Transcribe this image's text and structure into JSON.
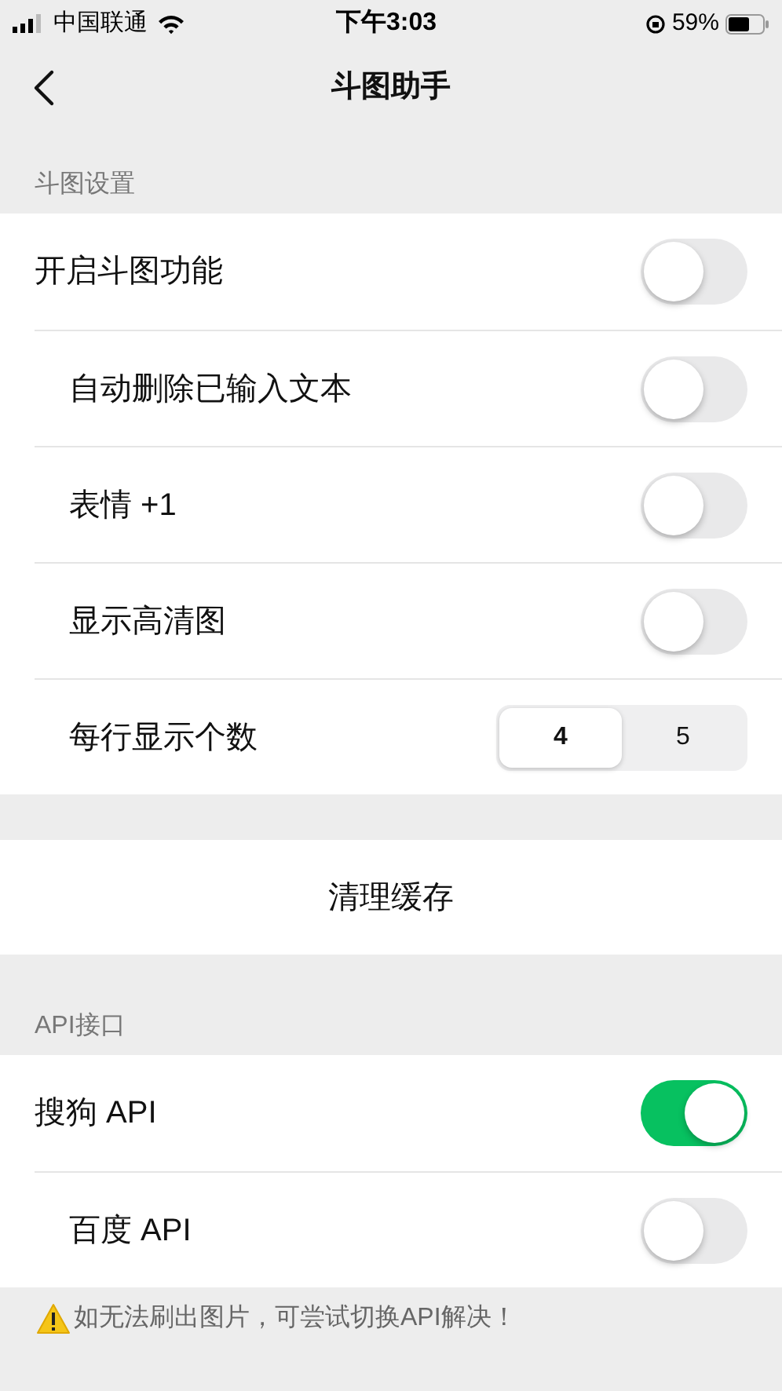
{
  "status_bar": {
    "carrier": "中国联通",
    "time": "下午3:03",
    "battery": "59%"
  },
  "nav": {
    "title": "斗图助手"
  },
  "sections": [
    {
      "header": "斗图设置",
      "rows": [
        {
          "kind": "toggle",
          "label": "开启斗图功能",
          "on": false
        },
        {
          "kind": "toggle",
          "label": "自动删除已输入文本",
          "on": false
        },
        {
          "kind": "toggle",
          "label": "表情 +1",
          "on": false
        },
        {
          "kind": "toggle",
          "label": "显示高清图",
          "on": false
        },
        {
          "kind": "segmented",
          "label": "每行显示个数",
          "options": [
            {
              "label": "4",
              "selected": true
            },
            {
              "label": "5",
              "selected": false
            }
          ]
        }
      ]
    },
    {
      "kind": "action",
      "button": "清理缓存"
    },
    {
      "header": "API接口",
      "rows": [
        {
          "kind": "toggle",
          "label": "搜狗 API",
          "on": true
        },
        {
          "kind": "toggle",
          "label": "百度 API",
          "on": false
        }
      ]
    }
  ],
  "footer": {
    "warning": "如无法刷出图片，可尝试切换API解决！"
  }
}
